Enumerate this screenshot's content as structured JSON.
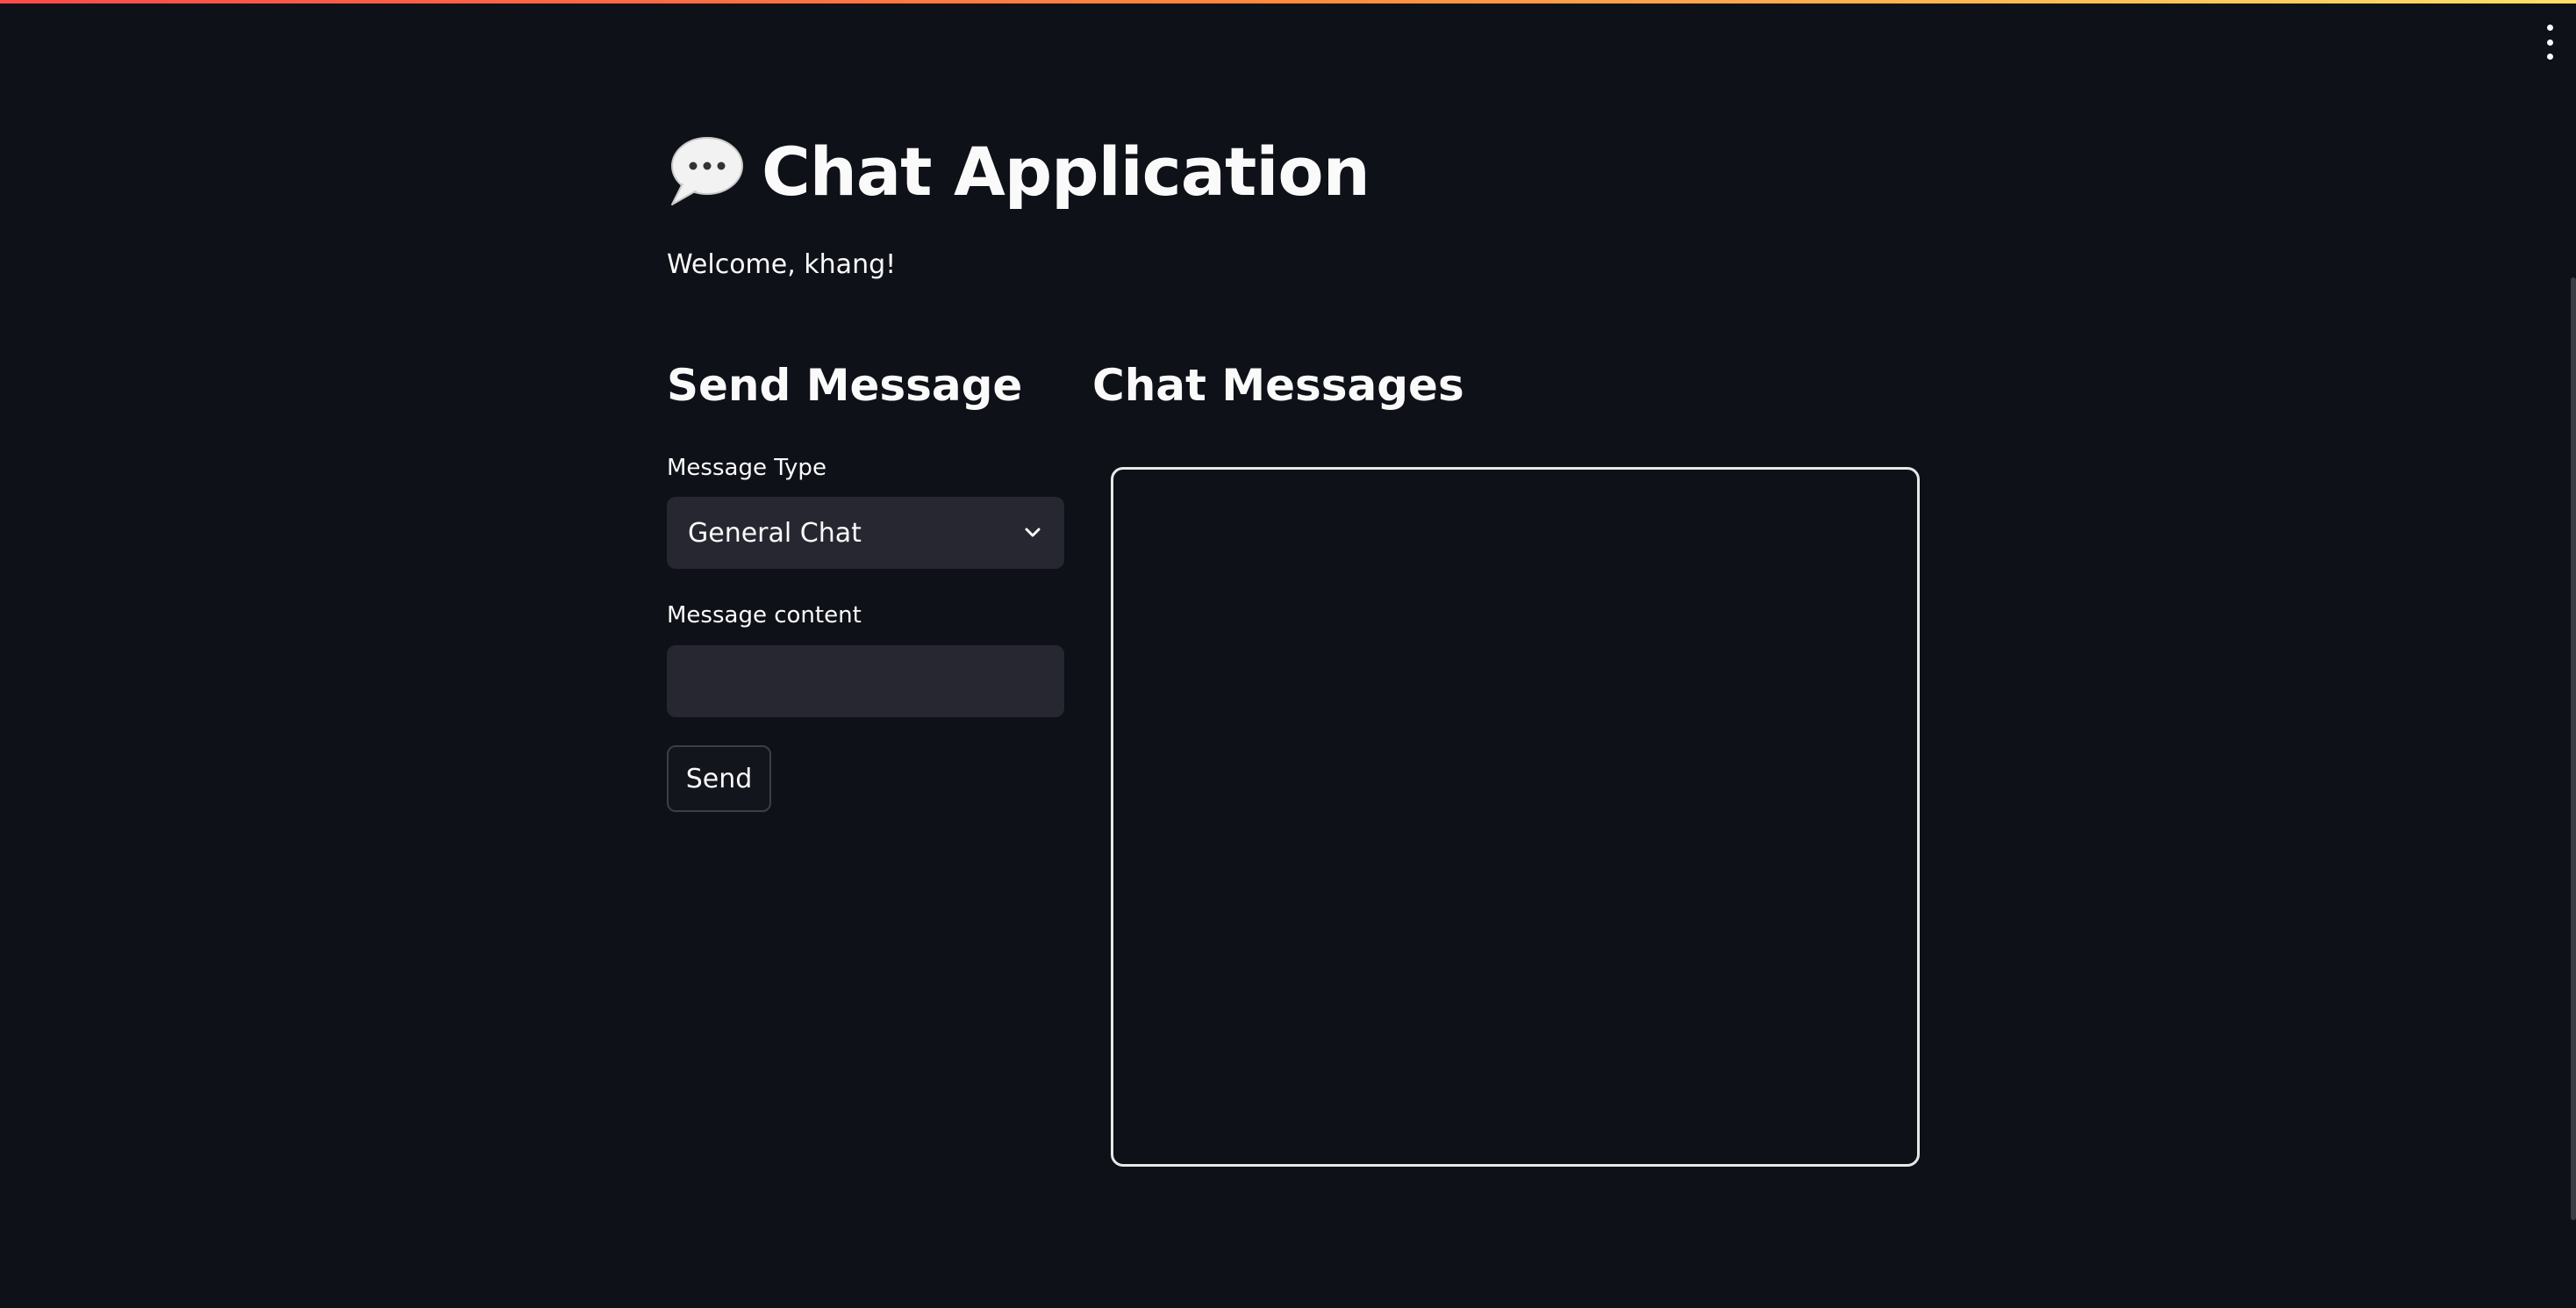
{
  "app": {
    "title": "Chat Application",
    "title_icon": "speech-bubble-icon",
    "welcome": "Welcome, khang!"
  },
  "send_section": {
    "heading": "Send Message",
    "message_type": {
      "label": "Message Type",
      "selected": "General Chat"
    },
    "message_content": {
      "label": "Message content",
      "value": "",
      "placeholder": ""
    },
    "send_label": "Send"
  },
  "chat_section": {
    "heading": "Chat Messages",
    "messages": []
  },
  "colors": {
    "background": "#0e1117",
    "input_background": "#262730",
    "text": "#fafafa",
    "accent_gradient": [
      "#ff4b4b",
      "#ffe066"
    ]
  }
}
